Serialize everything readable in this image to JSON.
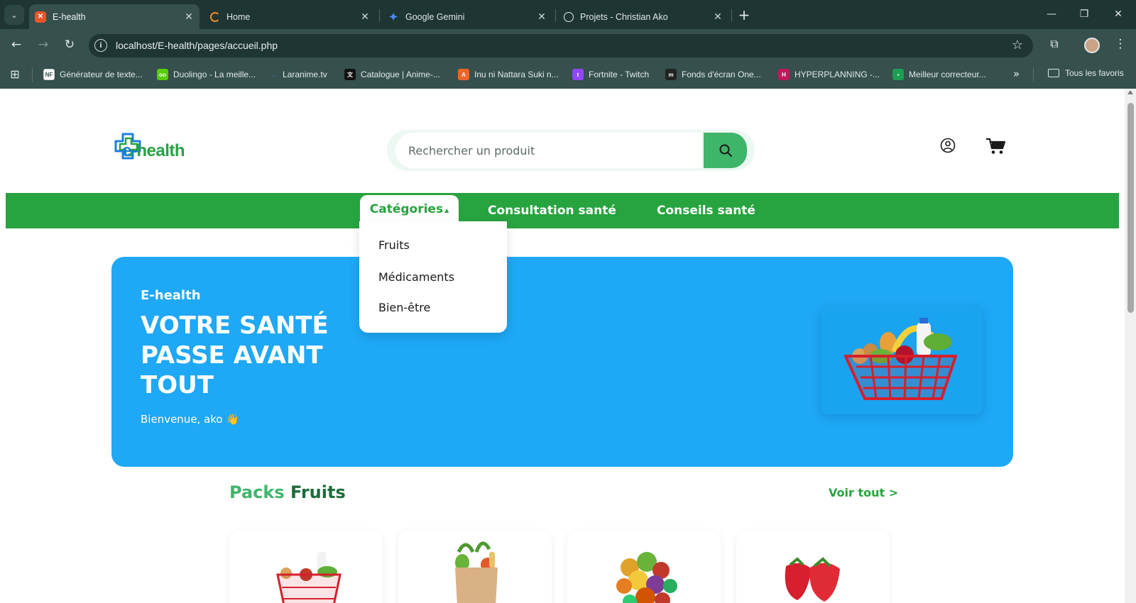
{
  "browser": {
    "tabs": [
      {
        "title": "E-health"
      },
      {
        "title": "Home"
      },
      {
        "title": "Google Gemini"
      },
      {
        "title": "Projets - Christian Ako"
      }
    ],
    "url": "localhost/E-health/pages/accueil.php",
    "bookmarks": [
      {
        "label": "Générateur de texte..."
      },
      {
        "label": "Duolingo - La meille..."
      },
      {
        "label": "Laranime.tv"
      },
      {
        "label": "Catalogue | Anime-..."
      },
      {
        "label": "Inu ni Nattara Suki n..."
      },
      {
        "label": "Fortnite - Twitch"
      },
      {
        "label": "Fonds d'écran One..."
      },
      {
        "label": "HYPERPLANNING -..."
      },
      {
        "label": "Meilleur correcteur..."
      }
    ],
    "all_bookmarks": "Tous les favoris"
  },
  "site": {
    "logo_prefix": "e-",
    "logo_suffix": "health",
    "search_placeholder": "Rechercher un produit",
    "nav": {
      "categories": "Catégories",
      "consultation": "Consultation santé",
      "conseils": "Conseils santé"
    },
    "dropdown": [
      "Fruits",
      "Médicaments",
      "Bien-être"
    ],
    "hero": {
      "brand": "E-health",
      "title": "VOTRE SANTÉ PASSE AVANT TOUT",
      "welcome": "Bienvenue, ako 👋"
    },
    "section": {
      "title_part1": "Packs",
      "title_part2": "Fruits",
      "see_all": "Voir tout  >"
    }
  },
  "colors": {
    "nav_green": "#27a33f",
    "hero_blue": "#1ea8f5",
    "search_green": "#3fb56a",
    "logo_blue": "#1f7de0"
  }
}
